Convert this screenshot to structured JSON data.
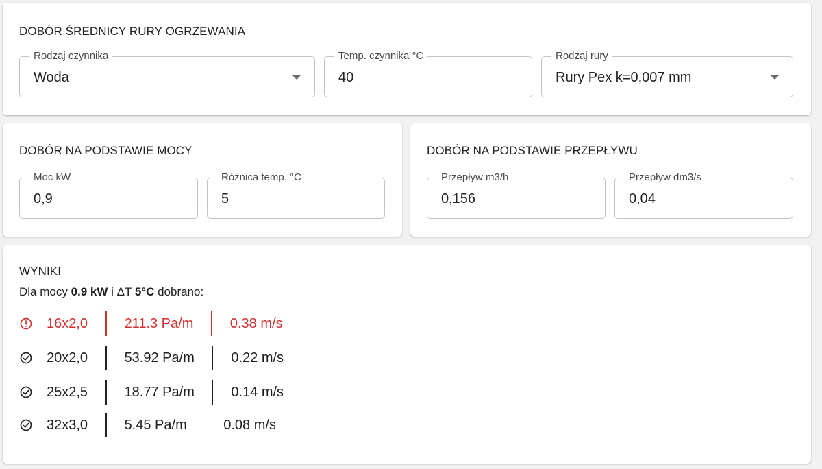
{
  "pipe_card": {
    "title": "DOBÓR ŚREDNICY RURY OGRZEWANIA",
    "medium": {
      "label": "Rodzaj czynnika",
      "value": "Woda"
    },
    "temp": {
      "label": "Temp. czynnika °C",
      "value": "40"
    },
    "pipe_type": {
      "label": "Rodzaj rury",
      "value": "Rury Pex k=0,007 mm"
    }
  },
  "power_card": {
    "title": "DOBÓR NA PODSTAWIE MOCY",
    "power": {
      "label": "Moc kW",
      "value": "0,9"
    },
    "delta": {
      "label": "Różnica temp. °C",
      "value": "5"
    }
  },
  "flow_card": {
    "title": "DOBÓR NA PODSTAWIE PRZEPŁYWU",
    "flow_m3h": {
      "label": "Przepływ m3/h",
      "value": "0,156"
    },
    "flow_dm3s": {
      "label": "Przepływ dm3/s",
      "value": "0,04"
    }
  },
  "results": {
    "title": "WYNIKI",
    "summary": {
      "prefix": "Dla mocy ",
      "power": "0.9 kW",
      "middle": " i ΔT ",
      "delta": "5°C",
      "suffix": " dobrano:"
    },
    "rows": [
      {
        "status": "warning",
        "icon": "alert-circle-icon",
        "size": "16x2,0",
        "pressure": "211.3 Pa/m",
        "velocity": "0.38 m/s"
      },
      {
        "status": "ok",
        "icon": "check-circle-icon",
        "size": "20x2,0",
        "pressure": "53.92 Pa/m",
        "velocity": "0.22 m/s"
      },
      {
        "status": "ok",
        "icon": "check-circle-icon",
        "size": "25x2,5",
        "pressure": "18.77 Pa/m",
        "velocity": "0.14 m/s"
      },
      {
        "status": "ok",
        "icon": "check-circle-icon",
        "size": "32x3,0",
        "pressure": "5.45 Pa/m",
        "velocity": "0.08 m/s"
      }
    ]
  },
  "colors": {
    "warning": "#d32f2f",
    "text": "#212121",
    "border": "#c4c4c4"
  }
}
